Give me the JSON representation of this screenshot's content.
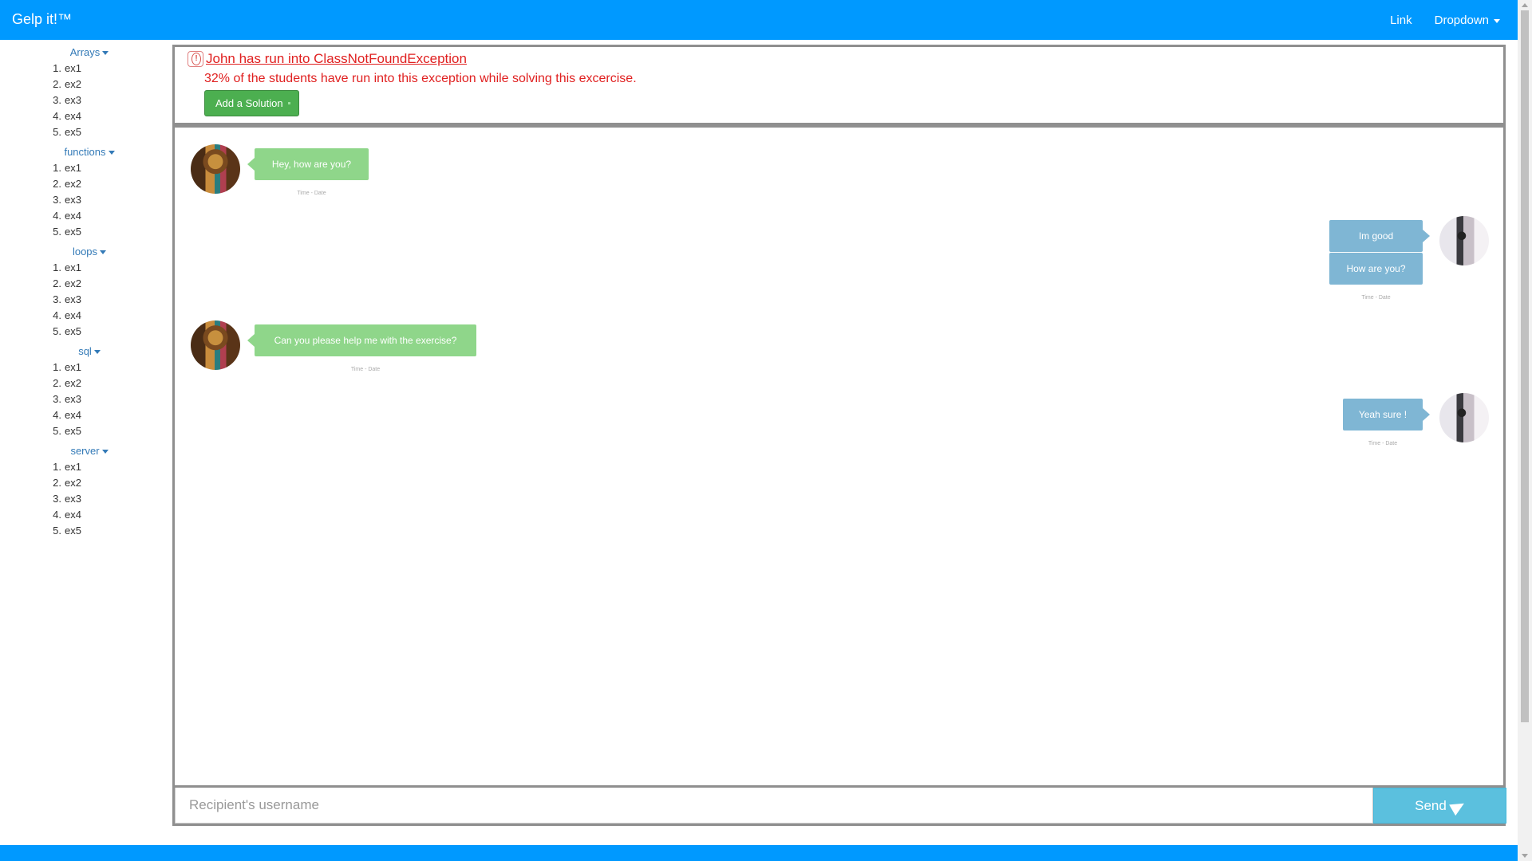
{
  "app": {
    "brand": "Gelp it!™"
  },
  "nav": {
    "link": "Link",
    "dropdown": "Dropdown"
  },
  "sidebar": {
    "categories": [
      {
        "name": "Arrays",
        "items": [
          {
            "n": "1.",
            "label": "ex1"
          },
          {
            "n": "2.",
            "label": "ex2"
          },
          {
            "n": "3.",
            "label": "ex3"
          },
          {
            "n": "4.",
            "label": "ex4"
          },
          {
            "n": "5.",
            "label": "ex5"
          }
        ]
      },
      {
        "name": "functions",
        "items": [
          {
            "n": "1.",
            "label": "ex1"
          },
          {
            "n": "2.",
            "label": "ex2"
          },
          {
            "n": "3.",
            "label": "ex3"
          },
          {
            "n": "4.",
            "label": "ex4"
          },
          {
            "n": "5.",
            "label": "ex5"
          }
        ]
      },
      {
        "name": "loops",
        "items": [
          {
            "n": "1.",
            "label": "ex1"
          },
          {
            "n": "2.",
            "label": "ex2"
          },
          {
            "n": "3.",
            "label": "ex3"
          },
          {
            "n": "4.",
            "label": "ex4"
          },
          {
            "n": "5.",
            "label": "ex5"
          }
        ]
      },
      {
        "name": "sql",
        "items": [
          {
            "n": "1.",
            "label": "ex1"
          },
          {
            "n": "2.",
            "label": "ex2"
          },
          {
            "n": "3.",
            "label": "ex3"
          },
          {
            "n": "4.",
            "label": "ex4"
          },
          {
            "n": "5.",
            "label": "ex5"
          }
        ]
      },
      {
        "name": "server",
        "items": [
          {
            "n": "1.",
            "label": "ex1"
          },
          {
            "n": "2.",
            "label": "ex2"
          },
          {
            "n": "3.",
            "label": "ex3"
          },
          {
            "n": "4.",
            "label": "ex4"
          },
          {
            "n": "5.",
            "label": "ex5"
          }
        ]
      }
    ]
  },
  "alert": {
    "title": "John has run into ClassNotFoundException",
    "subtitle": "32% of the students have run into this exception while solving this excercise.",
    "button_label": "Add a Solution",
    "icon": "alert-icon"
  },
  "chat": {
    "messages": [
      {
        "side": "left",
        "text": "Hey, how are you?",
        "meta": "Time - Date"
      },
      {
        "side": "right",
        "text": "Im good",
        "meta": ""
      },
      {
        "side": "right",
        "text": "How are you?",
        "meta": "Time - Date"
      },
      {
        "side": "left",
        "text": "Can you please help me with the exercise?",
        "meta": "Time - Date"
      },
      {
        "side": "right",
        "text": "Yeah sure !",
        "meta": "Time - Date"
      }
    ]
  },
  "composer": {
    "placeholder": "Recipient's username",
    "send_label": "Send",
    "send_icon": "paper-plane-icon"
  },
  "colors": {
    "navbar": "#0099ff",
    "alert_text": "#e02020",
    "green_bubble": "#8fd68a",
    "blue_bubble": "#7fb6d4",
    "send_button": "#5bc0de",
    "solution_button": "#4caf50"
  }
}
